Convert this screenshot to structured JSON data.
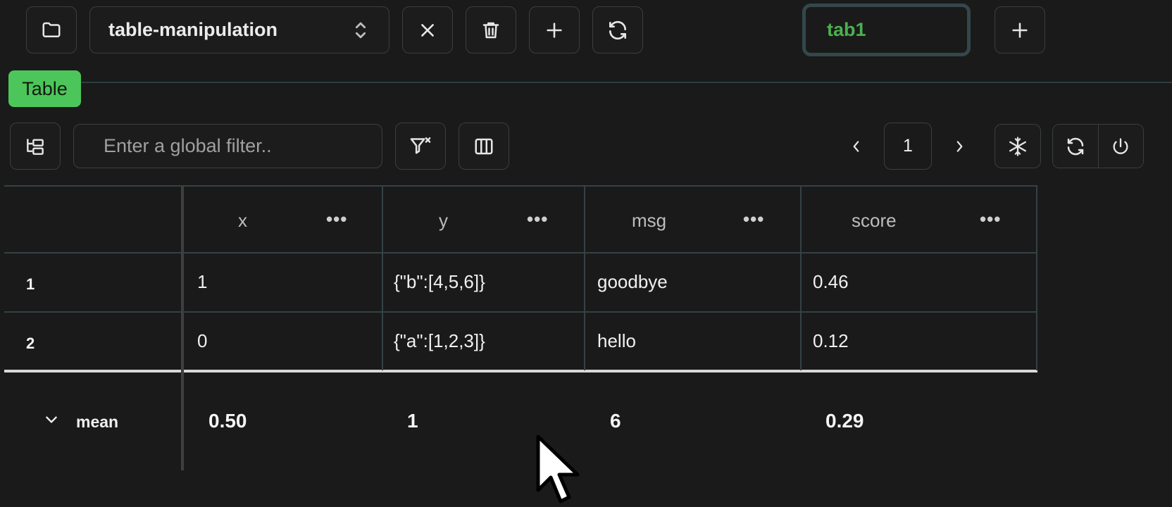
{
  "toolbar": {
    "notebook_select": "table-manipulation",
    "tab_name": "tab1"
  },
  "section": {
    "label": "Table"
  },
  "table_toolbar": {
    "filter_placeholder": "Enter a global filter..",
    "page_number": "1"
  },
  "table": {
    "columns": [
      {
        "label": "x"
      },
      {
        "label": "y"
      },
      {
        "label": "msg"
      },
      {
        "label": "score"
      }
    ],
    "column_menu_label": "•••",
    "rows": [
      {
        "index": "1",
        "cells": [
          "1",
          "{\"b\":[4,5,6]}",
          "goodbye",
          "0.46"
        ]
      },
      {
        "index": "2",
        "cells": [
          "0",
          "{\"a\":[1,2,3]}",
          "hello",
          "0.12"
        ]
      }
    ],
    "summary": {
      "label": "mean",
      "values": [
        "0.50",
        "1",
        "6",
        "0.29"
      ]
    }
  },
  "icons": {
    "folder": "folder-icon",
    "chevrons": "chevrons-up-down-icon",
    "close": "close-icon",
    "trash": "trash-icon",
    "add": "plus-icon",
    "refresh": "refresh-icon",
    "tree": "tree-icon",
    "filter_clear": "filter-clear-icon",
    "columns": "columns-icon",
    "prev": "chevron-left-icon",
    "next": "chevron-right-icon",
    "freeze": "snowflake-icon",
    "power": "power-icon",
    "summary_toggle": "chevron-down-icon",
    "cursor": "cursor-icon"
  },
  "colors": {
    "background": "#1a1a1a",
    "accent_green": "#4cc65a",
    "tab_text": "#4caf50",
    "border": "#3a3f3e"
  }
}
